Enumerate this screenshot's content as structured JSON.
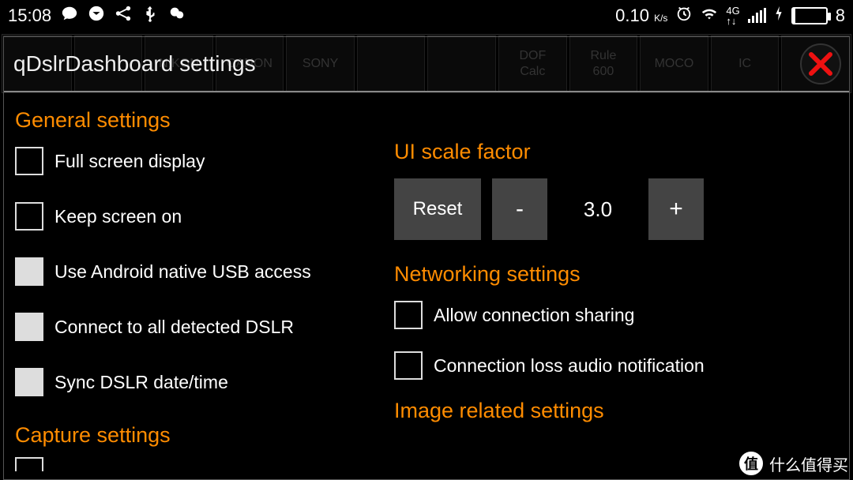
{
  "status": {
    "time": "15:08",
    "net_speed_value": "0.10",
    "net_speed_unit": "K/s",
    "network_gen": "4G",
    "battery_percent": "8"
  },
  "bg_tabs": [
    "",
    "",
    "NIKON",
    "CANON",
    "SONY",
    "",
    "",
    "DOF\nCalc",
    "Rule\n600",
    "MOCO",
    "IC",
    ""
  ],
  "modal": {
    "title": "qDslrDashboard settings",
    "sections": {
      "general_title": "General settings",
      "capture_title": "Capture settings",
      "ui_scale_title": "UI scale factor",
      "networking_title": "Networking settings",
      "image_title": "Image related settings"
    },
    "checkboxes": {
      "full_screen": {
        "label": "Full screen display",
        "checked": false
      },
      "keep_screen_on": {
        "label": "Keep screen on",
        "checked": false
      },
      "native_usb": {
        "label": "Use Android native USB access",
        "checked": true
      },
      "connect_all": {
        "label": "Connect to all detected DSLR",
        "checked": true
      },
      "sync_time": {
        "label": "Sync DSLR date/time",
        "checked": true
      },
      "allow_sharing": {
        "label": "Allow connection sharing",
        "checked": false
      },
      "loss_notify": {
        "label": "Connection loss audio notification",
        "checked": false
      }
    },
    "scale": {
      "reset_label": "Reset",
      "minus_label": "-",
      "plus_label": "+",
      "value": "3.0"
    }
  },
  "watermark": {
    "text": "什么值得买",
    "badge": "值"
  }
}
